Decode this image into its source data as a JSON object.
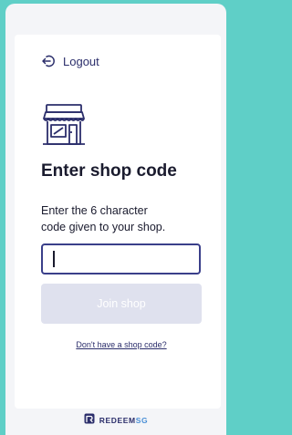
{
  "header": {
    "logout_label": "Logout"
  },
  "main": {
    "title": "Enter shop code",
    "description_line1": "Enter the 6 character",
    "description_line2": "code given to your shop.",
    "code_input": {
      "value": ""
    },
    "join_button_label": "Join shop",
    "no_code_link": "Don't have a shop code?"
  },
  "footer": {
    "brand_redeem": "REDEEM",
    "brand_sg": "SG"
  },
  "icons": {
    "logout": "logout-icon",
    "shop": "shop-icon",
    "brand_logo": "redeemsg-logo-icon"
  },
  "colors": {
    "background": "#5fcfc7",
    "primary": "#2b2e6b",
    "input_border": "#3a3f8a",
    "button_disabled": "#dfe1ee"
  }
}
